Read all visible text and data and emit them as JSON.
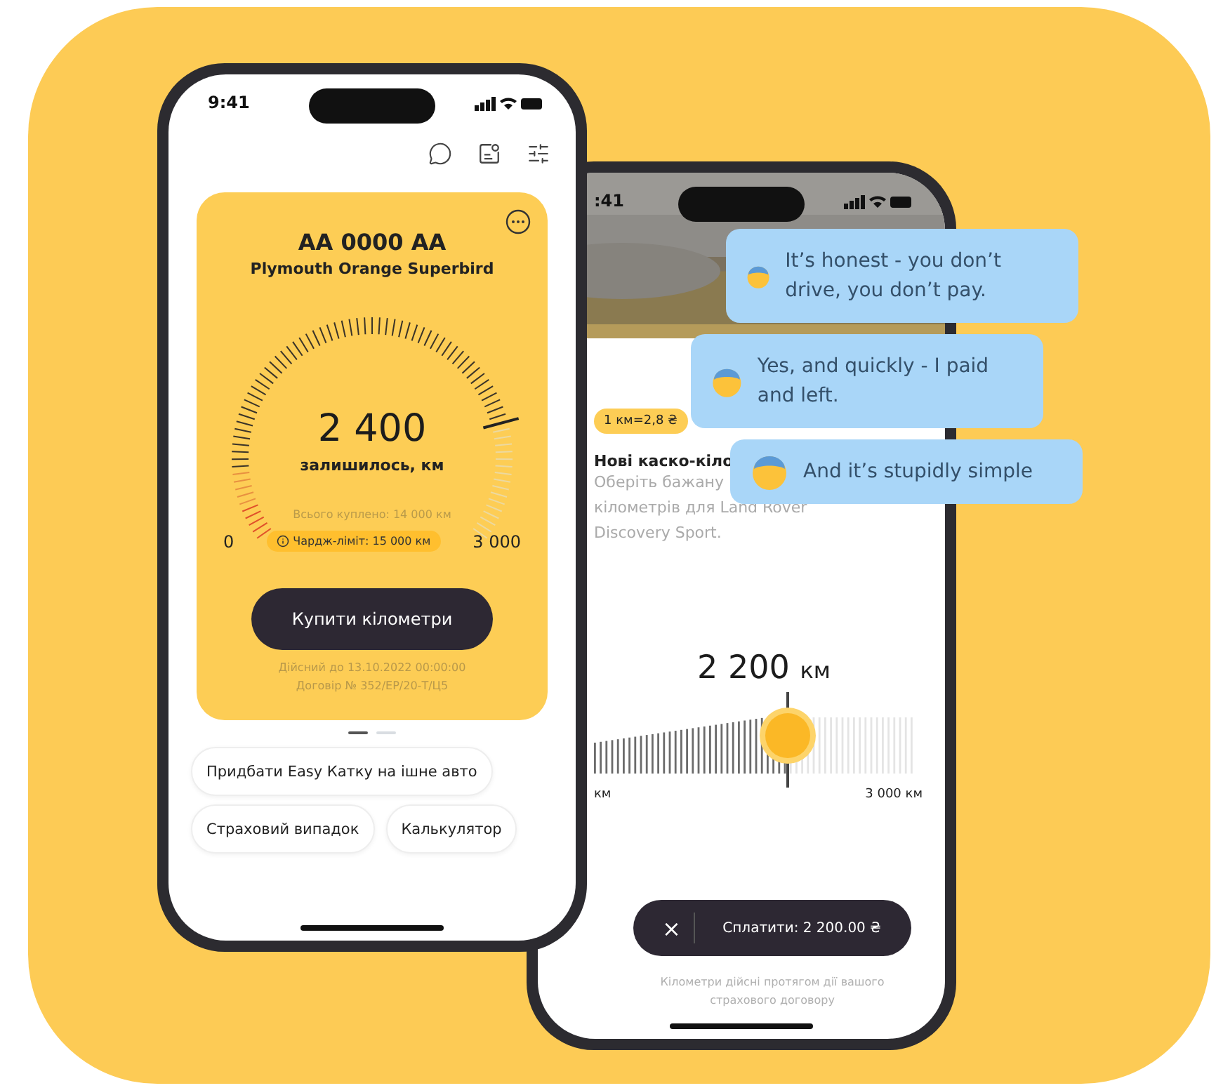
{
  "left_phone": {
    "status_time": "9:41",
    "card": {
      "plate": "AA 0000 AA",
      "car": "Plymouth Orange Superbird",
      "gauge": {
        "remaining": "2 400",
        "remaining_label": "залишилось, км",
        "total_bought": "Всього куплено: 14 000 км",
        "min": "0",
        "max": "3 000",
        "limit_badge": "Чардж-ліміт: 15 000 км"
      },
      "buy_button": "Купити кілометри",
      "valid_until": "Дійсний до 13.10.2022 00:00:00",
      "contract": "Договір № 352/EP/20-Т/Ц5"
    },
    "pager": [
      {
        "selected": true
      },
      {
        "selected": false
      }
    ],
    "chips": [
      "Придбати Easy Катку на ішне авто",
      "Страховий випадок",
      "Калькулятор"
    ]
  },
  "right_phone": {
    "status_time": ":41",
    "price_badge": "1 км=2,8 ₴",
    "title": "Нові каско-кіло",
    "description": [
      "Оберіть бажану",
      "кілометрів для Land Rover",
      "Discovery Sport."
    ],
    "slider": {
      "value": "2 200",
      "unit": "км",
      "min": "км",
      "max": "3 000 км"
    },
    "close": "×",
    "pay_button": "Сплатити: 2 200.00 ₴",
    "note": "Кілометри дійсні протягом дії вашого страхового договору"
  },
  "chat": [
    {
      "text": "It’s honest - you don’t drive, you don’t pay."
    },
    {
      "text": "Yes, and quickly - I paid and left."
    },
    {
      "text": "And it’s stupidly simple"
    }
  ]
}
